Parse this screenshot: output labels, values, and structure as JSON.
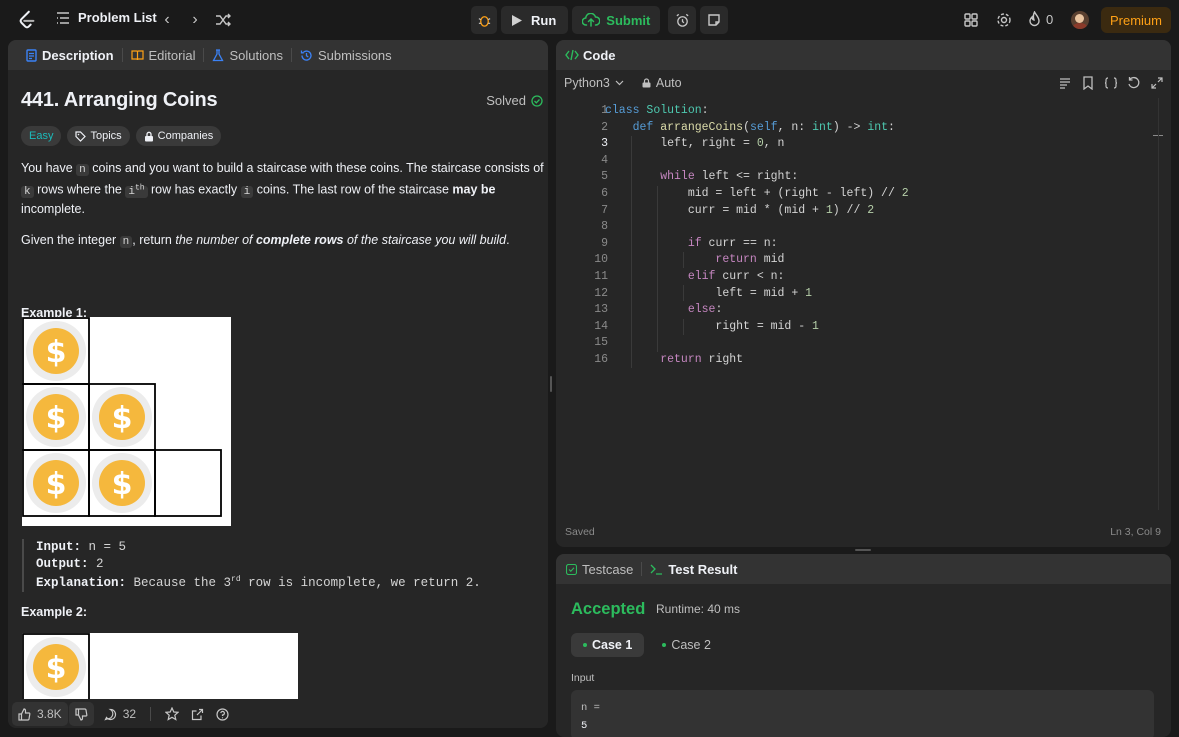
{
  "topbar": {
    "problem_list": "Problem List",
    "run": "Run",
    "submit": "Submit",
    "streak": "0",
    "premium": "Premium"
  },
  "desc_tabs": [
    "Description",
    "Editorial",
    "Solutions",
    "Submissions"
  ],
  "problem": {
    "title": "441. Arranging Coins",
    "solved": "Solved",
    "tags": [
      "Easy",
      "Topics",
      "Companies"
    ],
    "p1": "You have n coins and you want to build a staircase with these coins. The staircase consists of k rows where the ith row has exactly i coins. The last row of the staircase may be incomplete.",
    "p1_a": "You have ",
    "p1_code_n": "n",
    "p1_b": " coins and you want to build a staircase with these coins. The staircase consists of ",
    "p1_code_k": "k",
    "p1_c": " rows where the ",
    "p1_code_i": "i",
    "p1_sup": "th",
    "p1_d": " row has exactly ",
    "p1_code_i2": "i",
    "p1_e": " coins. The last row of the staircase ",
    "p1_bold": "may be",
    "p1_f": " incomplete.",
    "p2_a": "Given the integer ",
    "p2_code": "n",
    "p2_b": ", return ",
    "p2_i1": "the number of ",
    "p2_bi": "complete rows",
    "p2_i2": " of the staircase you will build",
    "p2_end": ".",
    "example1_title": "Example 1:",
    "example1_input_label": "Input:",
    "example1_input": " n = 5",
    "example1_output_label": "Output:",
    "example1_output": " 2",
    "example1_expl_label": "Explanation:",
    "example1_expl_a": " Because the 3",
    "example1_expl_sup": "rd",
    "example1_expl_b": " row is incomplete, we return 2.",
    "example2_title": "Example 2:"
  },
  "footer": {
    "likes": "3.8K",
    "comments": "32"
  },
  "code_panel": {
    "title": "Code",
    "language": "Python3",
    "mode": "Auto",
    "status": "Saved",
    "cursor": "Ln 3, Col 9",
    "line_numbers": [
      "1",
      "2",
      "3",
      "4",
      "5",
      "6",
      "7",
      "8",
      "9",
      "10",
      "11",
      "12",
      "13",
      "14",
      "15",
      "16"
    ]
  },
  "result_panel": {
    "tab_testcase": "Testcase",
    "tab_result": "Test Result",
    "verdict": "Accepted",
    "runtime": "Runtime: 40 ms",
    "cases": [
      "Case 1",
      "Case 2"
    ],
    "input_label": "Input",
    "input_var": "n =",
    "input_val": "5"
  },
  "colors": {
    "accent": "#ffa116",
    "accepted": "#2cbb5d",
    "easy": "#1cbaba"
  }
}
